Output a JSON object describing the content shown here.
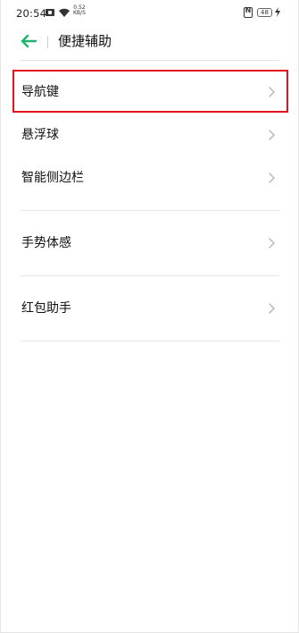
{
  "status_bar": {
    "time": "20:54",
    "net_speed_value": "0.52",
    "net_speed_unit": "KB/S",
    "battery": "48",
    "icons": [
      "message-icon",
      "wifi-icon",
      "nfc-icon",
      "battery-icon",
      "charging-icon"
    ]
  },
  "header": {
    "back_icon": "arrow-left-icon",
    "title": "便捷辅助"
  },
  "colors": {
    "accent": "#1fb36b",
    "highlight": "#e0141c",
    "chevron": "#b5b5b5"
  },
  "list": {
    "items": [
      {
        "label": "导航键",
        "icon": "chevron-right-icon"
      },
      {
        "label": "悬浮球",
        "icon": "chevron-right-icon"
      },
      {
        "label": "智能侧边栏",
        "icon": "chevron-right-icon"
      },
      {
        "label": "手势体感",
        "icon": "chevron-right-icon"
      },
      {
        "label": "红包助手",
        "icon": "chevron-right-icon"
      }
    ]
  }
}
